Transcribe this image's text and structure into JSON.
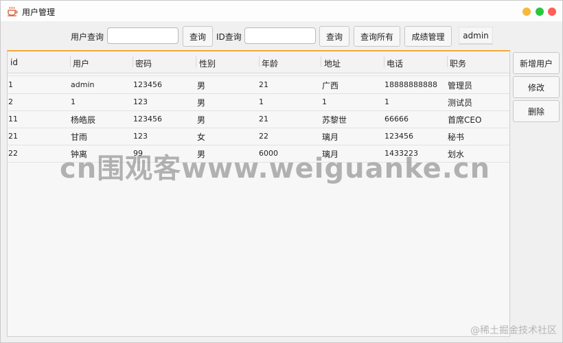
{
  "window": {
    "title": "用户管理",
    "traffic_colors": {
      "minimize": "#f5b93e",
      "maximize": "#28c840",
      "close": "#ff5f57"
    },
    "icon": "coffee-cup-icon"
  },
  "toolbar": {
    "user_query_label": "用户查询",
    "user_query_value": "",
    "query_button_1": "查询",
    "id_query_label": "ID查询",
    "id_query_value": "",
    "query_button_2": "查询",
    "query_all_button": "查询所有",
    "grades_button": "成绩管理",
    "current_user": "admin"
  },
  "table": {
    "accent": "#f3a93c",
    "columns": [
      "id",
      "用户",
      "密码",
      "性别",
      "年龄",
      "地址",
      "电话",
      "职务"
    ],
    "rows": [
      [
        "1",
        "admin",
        "123456",
        "男",
        "21",
        "广西",
        "18888888888",
        "管理员"
      ],
      [
        "2",
        "1",
        "123",
        "男",
        "1",
        "1",
        "1",
        "测试员"
      ],
      [
        "11",
        "杨皓辰",
        "123456",
        "男",
        "21",
        "苏黎世",
        "66666",
        "首席CEO"
      ],
      [
        "21",
        "甘雨",
        "123",
        "女",
        "22",
        "璃月",
        "123456",
        "秘书"
      ],
      [
        "22",
        "钟离",
        "99",
        "男",
        "6000",
        "璃月",
        "1433223",
        "划水"
      ]
    ]
  },
  "side_actions": {
    "add_user": "新增用户",
    "edit": "修改",
    "delete": "删除"
  },
  "watermark": "cn围观客www.weiguanke.cn",
  "footer_mark": "@稀土掘金技术社区"
}
